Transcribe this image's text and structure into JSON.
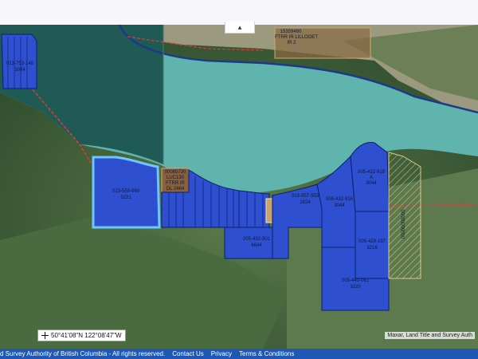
{
  "map": {
    "top_label": {
      "line1": "15359460",
      "line2": "FTRR IR LILLOOET",
      "line3": "IR 2"
    },
    "reserve_label": {
      "line1": "00085730",
      "line2": "LUC130",
      "line3": "FTRR IR",
      "line4": "DL 2464"
    },
    "parcels": [
      {
        "id": "013-753-148",
        "num": "3084"
      },
      {
        "id": "013-559-660",
        "num": "3221"
      },
      {
        "id": "005-432-901",
        "num": "6644"
      },
      {
        "id": "013-557-553",
        "num": "1624"
      },
      {
        "id": "005-432-916",
        "num": "3044"
      },
      {
        "id": "005-432-918",
        "extra": "A",
        "num": "3044"
      },
      {
        "id": "005-429-187",
        "num": "3218"
      },
      {
        "id": "005-440-061",
        "num": "3220"
      }
    ],
    "hatched_label": "00000000000"
  },
  "coordinates": "50°41'08\"N 122°08'47\"W",
  "attribution": "Maxar, Land Title and Survey Auth",
  "footer": {
    "copyright": "d Survey Authority of British Columbia - All rights reserved.",
    "contact": "Contact Us",
    "privacy": "Privacy",
    "terms": "Terms & Conditions"
  },
  "colors": {
    "parcel_fill": "#2d4fd0",
    "parcel_border": "#0c1f6b",
    "selected_border": "#6ec6ff",
    "lake": "#5fb4ad",
    "deep_water": "#1f5b54",
    "footer": "#1f57b4"
  }
}
